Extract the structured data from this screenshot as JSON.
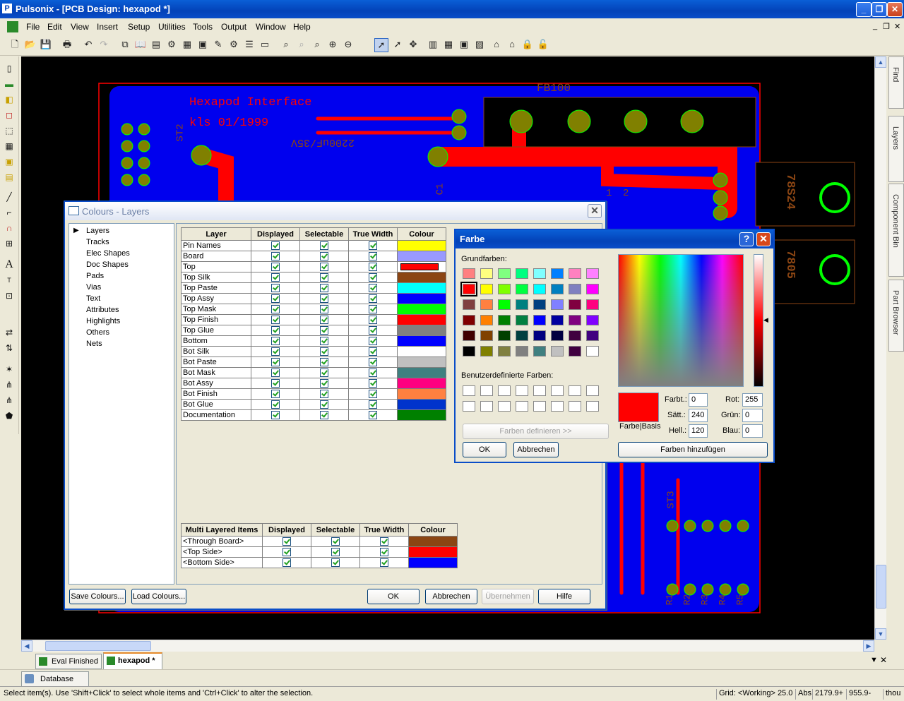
{
  "window": {
    "title": "Pulsonix - [PCB Design: hexapod *]",
    "app_icon": "pulsonix-icon"
  },
  "menu": [
    "File",
    "Edit",
    "View",
    "Insert",
    "Setup",
    "Utilities",
    "Tools",
    "Output",
    "Window",
    "Help"
  ],
  "pcb": {
    "board_title_1": "Hexapod Interface",
    "board_title_2": "kls 01/1999",
    "label_fb": "FB100",
    "label_cap": "2200uF/35V",
    "label_reg1": "78S24",
    "label_reg2": "7805",
    "label_st2": "ST2",
    "label_st3": "ST3",
    "label_c1": "C1",
    "label_1": "1",
    "label_2": "2",
    "resistors": [
      "R1",
      "R2",
      "R3",
      "R4",
      "R5"
    ],
    "colors": {
      "board_outline": "#ff0000",
      "top": "#ff0000",
      "bottom": "#0000ff",
      "pad": "#808000",
      "silk": "#8b4513"
    }
  },
  "right_tabs": [
    "Find",
    "Layers",
    "Component Bin",
    "Part Browser"
  ],
  "doc_tabs": [
    "Eval Finished",
    "hexapod *"
  ],
  "db_tab": "Database",
  "status": {
    "message": "Select item(s). Use 'Shift+Click' to select whole items and 'Ctrl+Click' to alter the selection.",
    "grid": "Grid: <Working> 25.0",
    "abs": "Abs",
    "x": "2179.9+",
    "y": "955.9-",
    "units": "thou"
  },
  "colours_dialog": {
    "title": "Colours - Layers",
    "tree": [
      "Layers",
      "Tracks",
      "Elec Shapes",
      "Doc Shapes",
      "Pads",
      "Vias",
      "Text",
      "Attributes",
      "Highlights",
      "Others",
      "Nets"
    ],
    "headers": [
      "Layer",
      "Displayed",
      "Selectable",
      "True Width",
      "Colour"
    ],
    "rows": [
      {
        "name": "Pin Names",
        "color": "#ffff00"
      },
      {
        "name": "Board",
        "color": "#9999ff"
      },
      {
        "name": "Top",
        "color": "#ff0000"
      },
      {
        "name": "Top Silk",
        "color": "#8b4513"
      },
      {
        "name": "Top Paste",
        "color": "#00ffff"
      },
      {
        "name": "Top Assy",
        "color": "#0000ff"
      },
      {
        "name": "Top Mask",
        "color": "#00ff00"
      },
      {
        "name": "Top Finish",
        "color": "#ff0000"
      },
      {
        "name": "Top Glue",
        "color": "#808080"
      },
      {
        "name": "Bottom",
        "color": "#0000ff"
      },
      {
        "name": "Bot Silk",
        "color": "#ffffff"
      },
      {
        "name": "Bot Paste",
        "color": "#c0c0c0"
      },
      {
        "name": "Bot Mask",
        "color": "#408080"
      },
      {
        "name": "Bot Assy",
        "color": "#ff0080"
      },
      {
        "name": "Bot Finish",
        "color": "#ff8040"
      },
      {
        "name": "Bot Glue",
        "color": "#0033cc"
      },
      {
        "name": "Documentation",
        "color": "#008000"
      }
    ],
    "multi_headers": [
      "Multi Layered Items",
      "Displayed",
      "Selectable",
      "True Width",
      "Colour"
    ],
    "multi_rows": [
      {
        "name": "<Through Board>",
        "color": "#8b4513"
      },
      {
        "name": "<Top Side>",
        "color": "#ff0000"
      },
      {
        "name": "<Bottom Side>",
        "color": "#0000ff"
      }
    ],
    "buttons": {
      "save": "Save Colours...",
      "load": "Load Colours...",
      "ok": "OK",
      "cancel": "Abbrechen",
      "apply": "Übernehmen",
      "help": "Hilfe"
    }
  },
  "farbe_dialog": {
    "title": "Farbe",
    "basic_label": "Grundfarben:",
    "custom_label": "Benutzerdefinierte Farben:",
    "define_button": "Farben definieren >>",
    "ok": "OK",
    "cancel": "Abbrechen",
    "add_button": "Farben hinzufügen",
    "preview_label": "Farbe|Basis",
    "hue_label": "Farbt.:",
    "hue": "0",
    "sat_label": "Sätt.:",
    "sat": "240",
    "lum_label": "Hell.:",
    "lum": "120",
    "red_label": "Rot:",
    "red": "255",
    "green_label": "Grün:",
    "green": "0",
    "blue_label": "Blau:",
    "blue": "0",
    "basic_colors": [
      "#ff8080",
      "#ffff80",
      "#80ff80",
      "#00ff80",
      "#80ffff",
      "#0080ff",
      "#ff80c0",
      "#ff80ff",
      "#ff0000",
      "#ffff00",
      "#80ff00",
      "#00ff40",
      "#00ffff",
      "#0080c0",
      "#8080c0",
      "#ff00ff",
      "#804040",
      "#ff8040",
      "#00ff00",
      "#008080",
      "#004080",
      "#8080ff",
      "#800040",
      "#ff0080",
      "#800000",
      "#ff8000",
      "#008000",
      "#008040",
      "#0000ff",
      "#0000a0",
      "#800080",
      "#8000ff",
      "#400000",
      "#804000",
      "#004000",
      "#004040",
      "#000080",
      "#000040",
      "#400040",
      "#400080",
      "#000000",
      "#808000",
      "#808040",
      "#808080",
      "#408080",
      "#c0c0c0",
      "#400040",
      "#ffffff"
    ],
    "selected_color": "#ff0000"
  }
}
